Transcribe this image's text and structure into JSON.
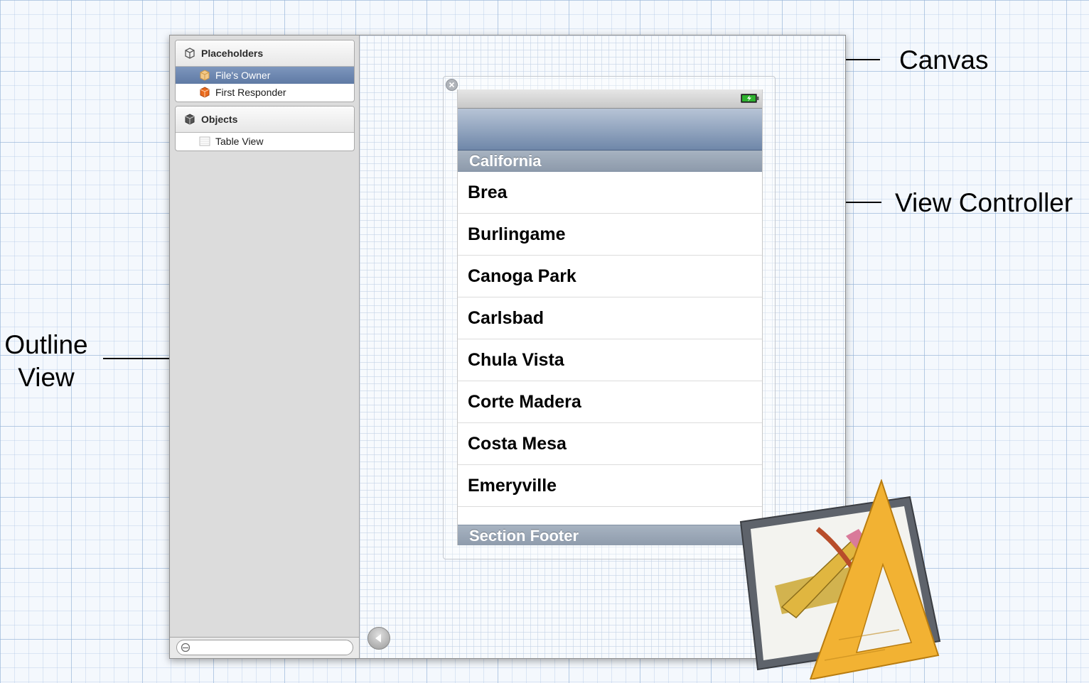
{
  "callouts": {
    "canvas": "Canvas",
    "view_controller": "View Controller",
    "outline_line1": "Outline",
    "outline_line2": "View"
  },
  "outline": {
    "placeholders_title": "Placeholders",
    "placeholders": [
      {
        "label": "File's Owner",
        "icon": "files-owner-cube-icon",
        "selected": true
      },
      {
        "label": "First Responder",
        "icon": "first-responder-cube-icon",
        "selected": false
      }
    ],
    "objects_title": "Objects",
    "objects": [
      {
        "label": "Table View",
        "icon": "table-view-icon"
      }
    ]
  },
  "table": {
    "section_header": "California",
    "rows": [
      "Brea",
      "Burlingame",
      "Canoga Park",
      "Carlsbad",
      "Chula Vista",
      "Corte Madera",
      "Costa Mesa",
      "Emeryville"
    ],
    "section_footer": "Section Footer"
  },
  "colors": {
    "selection": "#6f88b0",
    "nav_bar": "#8398b6",
    "section_bar": "#98a5b5",
    "battery": "#2fb22f"
  }
}
